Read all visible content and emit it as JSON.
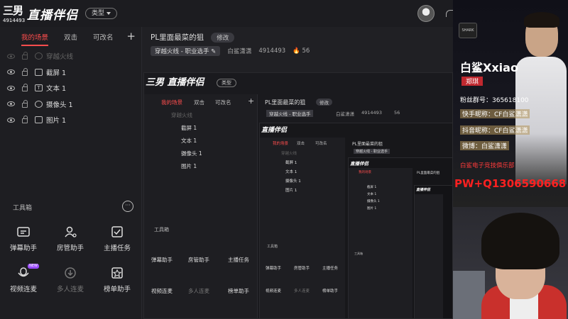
{
  "app": {
    "logo_mark": "三男",
    "logo_id": "4914493",
    "logo_text": "直播伴侣",
    "type_button": "类型"
  },
  "left": {
    "tabs": [
      {
        "label": "我的场景",
        "active": true
      },
      {
        "label": "双击",
        "active": false
      },
      {
        "label": "可改名",
        "active": false
      }
    ],
    "add": "+",
    "sources": [
      {
        "label": "穿越火线",
        "icon": "game-icon",
        "hidden": true
      },
      {
        "label": "截屏 1",
        "icon": "screenshot-icon",
        "hidden": false
      },
      {
        "label": "文本 1",
        "icon": "text-icon",
        "hidden": false
      },
      {
        "label": "摄像头 1",
        "icon": "camera-icon",
        "hidden": false
      },
      {
        "label": "图片 1",
        "icon": "image-icon",
        "hidden": false
      }
    ],
    "toolbox_title": "工具箱",
    "more": "···",
    "tools": [
      {
        "label": "弹幕助手",
        "icon": "danmaku-icon",
        "dim": false
      },
      {
        "label": "房管助手",
        "icon": "room-admin-icon",
        "dim": false
      },
      {
        "label": "主播任务",
        "icon": "task-icon",
        "dim": false
      },
      {
        "label": "视频连麦",
        "icon": "video-link-icon",
        "dim": false,
        "badge": "NEW"
      },
      {
        "label": "多人连麦",
        "icon": "multi-link-icon",
        "dim": true
      },
      {
        "label": "榜单助手",
        "icon": "ranking-icon",
        "dim": false
      }
    ]
  },
  "main": {
    "scene_title": "PL里面最菜的狙",
    "edit": "修改",
    "category": "穿越火线 - 职业选手",
    "streamer": "白鲨潇潇",
    "room_id": "4914493",
    "heat": "56"
  },
  "cam": {
    "name": "白鲨Xxiao",
    "real_name": "郑琪",
    "fans_group": "粉丝群号：365618100",
    "kuaishou": "快手昵称：CF白鲨潇潇",
    "douyin": "抖音昵称：CF白鲨潇潇",
    "weibo": "微博：白鲨潇潇",
    "club": "白鲨电子竞技俱乐部",
    "contact": "PW+Q1306590668",
    "team_logo": "SHARK"
  },
  "colors": {
    "accent": "#ff4d4d",
    "bg": "#1a1a1e",
    "panel": "#1e1e22"
  }
}
